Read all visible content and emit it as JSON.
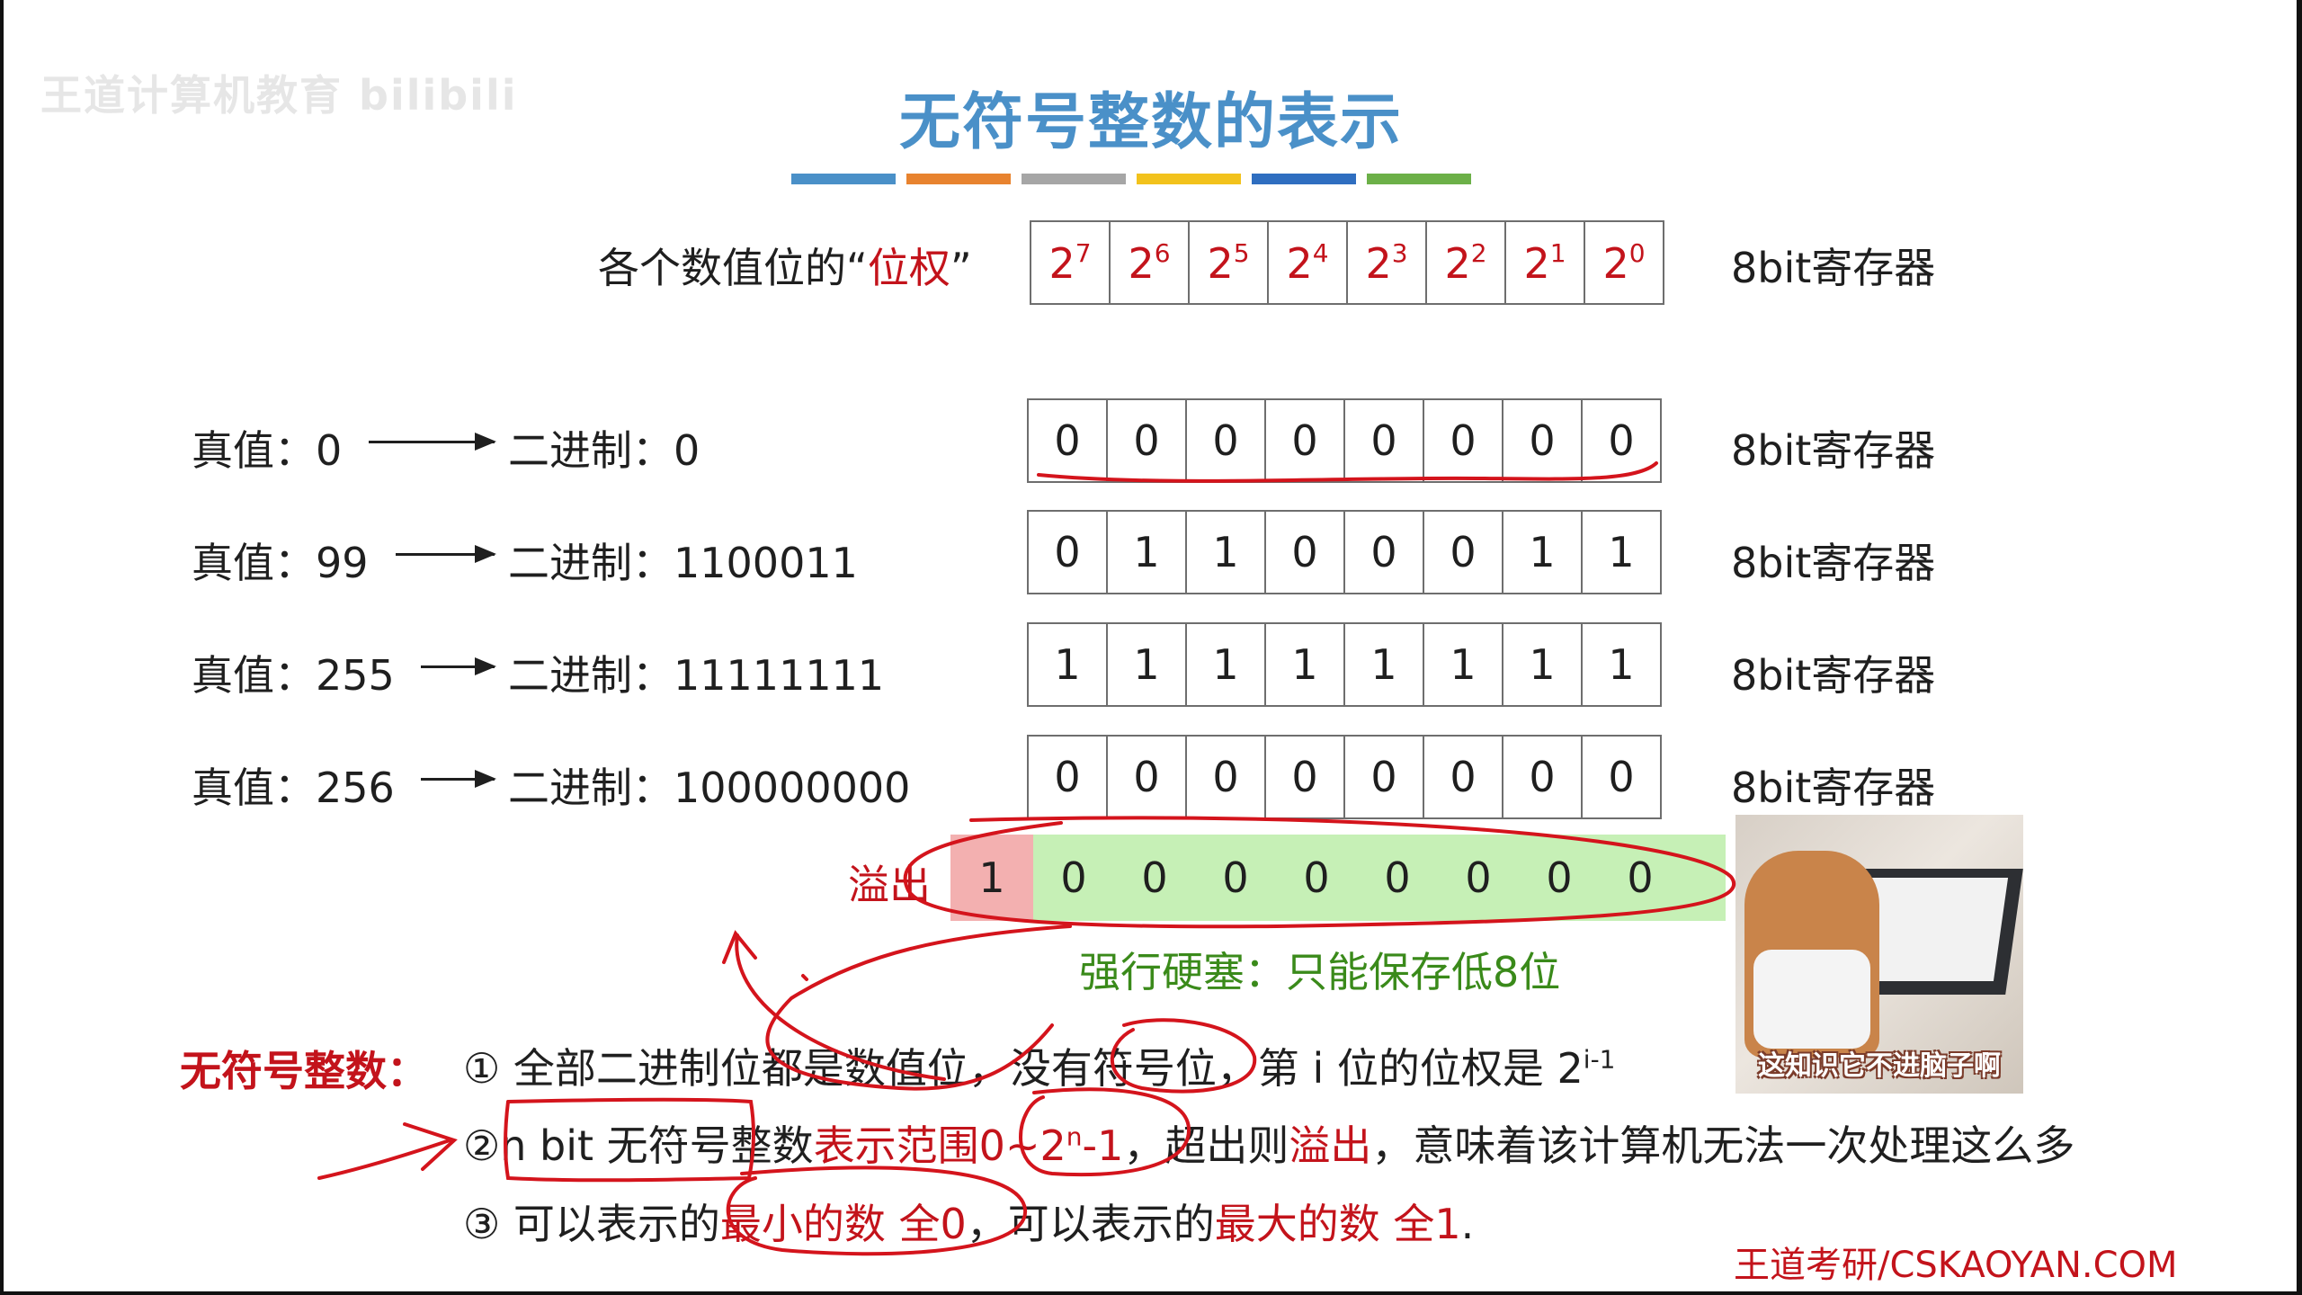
{
  "watermark": "王道计算机教育 bilibili",
  "title": "无符号整数的表示",
  "colors": {
    "title": "#4a90c8",
    "accent_red": "#c3131b",
    "accent_green": "#3a8a1a",
    "overflow_bit_bg": "#f3b0b0",
    "kept_bits_bg": "#c6f0b6",
    "bars": [
      "#4a90c8",
      "#e8832f",
      "#a6a6a6",
      "#f2c21c",
      "#2f6ec0",
      "#6cb048"
    ]
  },
  "weights": {
    "label_prefix": "各个数值位的“",
    "label_highlight": "位权",
    "label_suffix": "”",
    "cells": [
      {
        "base": "2",
        "exp": "7"
      },
      {
        "base": "2",
        "exp": "6"
      },
      {
        "base": "2",
        "exp": "5"
      },
      {
        "base": "2",
        "exp": "4"
      },
      {
        "base": "2",
        "exp": "3"
      },
      {
        "base": "2",
        "exp": "2"
      },
      {
        "base": "2",
        "exp": "1"
      },
      {
        "base": "2",
        "exp": "0"
      }
    ],
    "register_label": "8bit寄存器"
  },
  "examples": [
    {
      "true_value": "真值：0",
      "binary": "二进制：0",
      "bits": [
        "0",
        "0",
        "0",
        "0",
        "0",
        "0",
        "0",
        "0"
      ],
      "register_label": "8bit寄存器"
    },
    {
      "true_value": "真值：99",
      "binary": "二进制：1100011",
      "bits": [
        "0",
        "1",
        "1",
        "0",
        "0",
        "0",
        "1",
        "1"
      ],
      "register_label": "8bit寄存器"
    },
    {
      "true_value": "真值：255",
      "binary": "二进制：11111111",
      "bits": [
        "1",
        "1",
        "1",
        "1",
        "1",
        "1",
        "1",
        "1"
      ],
      "register_label": "8bit寄存器"
    },
    {
      "true_value": "真值：256",
      "binary": "二进制：100000000",
      "bits": [
        "0",
        "0",
        "0",
        "0",
        "0",
        "0",
        "0",
        "0"
      ],
      "register_label": "8bit寄存器"
    }
  ],
  "overflow": {
    "label": "溢出",
    "overflow_bit": "1",
    "kept_bits": [
      "0",
      "0",
      "0",
      "0",
      "0",
      "0",
      "0",
      "0"
    ],
    "note": "强行硬塞：只能保存低8位"
  },
  "thumbnail": {
    "caption": "这知识它不进脑子啊"
  },
  "summary": {
    "heading": "无符号整数：",
    "point1": {
      "num": "①",
      "text": "全部二进制位都是数值位，没有符号位，第 i 位的位权是 2",
      "sup": "i-1"
    },
    "point2": {
      "num": "②",
      "pre": "n bit 无符号整数",
      "red1": "表示范围",
      "range_base": "0~2",
      "range_sup": "n",
      "range_tail": "-1",
      "mid": "，超出则",
      "red2": "溢出",
      "post": "，意味着该计算机无法一次处理这么多"
    },
    "point3": {
      "num": "③",
      "pre": "可以表示的",
      "red1": "最小的数 全0",
      "mid": "，可以表示的",
      "red2": "最大的数 全1",
      "post": "."
    }
  },
  "footer": "王道考研/CSKAOYAN.COM"
}
